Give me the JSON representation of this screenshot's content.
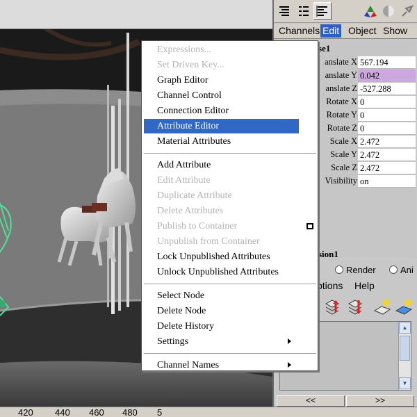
{
  "colors": {
    "menu_highlight": "#3168c8",
    "active_tab": "#2d5fc6",
    "highlight_value": "#cda8e0",
    "disabled_text": "#b4b4b4",
    "wireframe_green": "#4fe09a"
  },
  "ruler": [
    "420",
    "440",
    "460",
    "480",
    "5"
  ],
  "right_panel": {
    "icons": [
      "channel-box-icon",
      "attribute-editor-icon",
      "tool-settings-icon",
      "axis-icon",
      "shading-icon",
      "pin-icon"
    ],
    "tabs": [
      {
        "label": "Channels",
        "active": false
      },
      {
        "label": "Edit",
        "active": true
      },
      {
        "label": "Object",
        "active": false
      },
      {
        "label": "Show",
        "active": false
      }
    ],
    "channel_box": {
      "object_name": "se1",
      "rows": [
        {
          "label": "anslate X",
          "value": "567.194",
          "highlight": false
        },
        {
          "label": "anslate Y",
          "value": "0.042",
          "highlight": true
        },
        {
          "label": "anslate Z",
          "value": "-527.288",
          "highlight": false
        },
        {
          "label": "Rotate X",
          "value": "0",
          "highlight": false
        },
        {
          "label": "Rotate Y",
          "value": "0",
          "highlight": false
        },
        {
          "label": "Rotate Z",
          "value": "0",
          "highlight": false
        },
        {
          "label": "Scale X",
          "value": "2.472",
          "highlight": false
        },
        {
          "label": "Scale Y",
          "value": "2.472",
          "highlight": false
        },
        {
          "label": "Scale Z",
          "value": "2.472",
          "highlight": false
        },
        {
          "label": "Visibility",
          "value": "on",
          "highlight": false
        }
      ],
      "shapes_label": "sion1"
    },
    "layer_area": {
      "radios": [
        "Render",
        "Ani"
      ],
      "menu": [
        "ptions",
        "Help"
      ],
      "nav_prev": "<<",
      "nav_next": ">>"
    }
  },
  "context_menu": {
    "items": [
      {
        "label": "Expressions...",
        "disabled": true
      },
      {
        "label": "Set Driven Key...",
        "disabled": true
      },
      {
        "label": "Graph Editor",
        "disabled": false
      },
      {
        "label": "Channel Control",
        "disabled": false
      },
      {
        "label": "Connection Editor",
        "disabled": false
      },
      {
        "label": "Attribute Editor",
        "disabled": false,
        "selected": true
      },
      {
        "label": "Material Attributes",
        "disabled": false
      },
      {
        "separator": true
      },
      {
        "label": "Add Attribute",
        "disabled": false
      },
      {
        "label": "Edit Attribute",
        "disabled": true
      },
      {
        "label": "Duplicate Attribute",
        "disabled": true
      },
      {
        "label": "Delete Attributes",
        "disabled": true
      },
      {
        "label": "Publish to Container",
        "disabled": true,
        "option_box": true
      },
      {
        "label": "Unpublish from Container",
        "disabled": true
      },
      {
        "label": "Lock Unpublished Attributes",
        "disabled": false
      },
      {
        "label": "Unlock Unpublished Attributes",
        "disabled": false
      },
      {
        "separator": true
      },
      {
        "label": "Select Node",
        "disabled": false
      },
      {
        "label": "Delete Node",
        "disabled": false
      },
      {
        "label": "Delete History",
        "disabled": false
      },
      {
        "label": "Settings",
        "disabled": false,
        "submenu": true
      },
      {
        "separator": true
      },
      {
        "label": "Channel Names",
        "disabled": false,
        "submenu": true
      }
    ]
  }
}
